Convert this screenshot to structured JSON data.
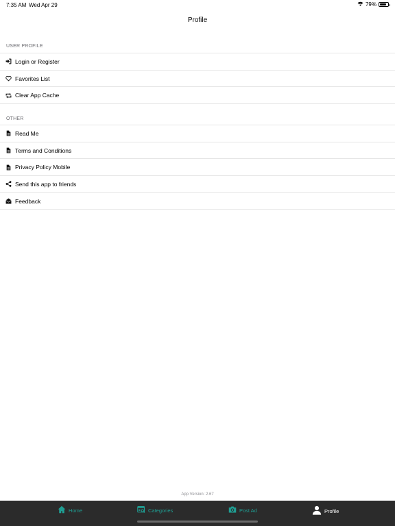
{
  "status_bar": {
    "time": "7:35 AM",
    "date": "Wed Apr 29",
    "battery": "79%",
    "battery_level": 0.79
  },
  "nav": {
    "title": "Profile"
  },
  "sections": [
    {
      "header": "USER PROFILE",
      "items": [
        {
          "label": "Login or Register",
          "icon": "sign-in-icon"
        },
        {
          "label": "Favorites List",
          "icon": "heart-icon"
        },
        {
          "label": "Clear App Cache",
          "icon": "retweet-icon"
        }
      ]
    },
    {
      "header": "OTHER",
      "items": [
        {
          "label": "Read Me",
          "icon": "document-icon"
        },
        {
          "label": "Terms and Conditions",
          "icon": "document-icon"
        },
        {
          "label": "Privacy Policy Mobile",
          "icon": "document-icon"
        },
        {
          "label": "Send this app to friends",
          "icon": "share-icon"
        },
        {
          "label": "Feedback",
          "icon": "envelope-open-icon"
        }
      ]
    }
  ],
  "footer": {
    "app_version": "App Version: 2.67"
  },
  "tab_bar": {
    "accent_color": "#1f9e93",
    "active_color": "#ffffff",
    "background": "#2b2b2b",
    "tabs": [
      {
        "label": "Home",
        "icon": "home-icon"
      },
      {
        "label": "Categories",
        "icon": "categories-icon"
      },
      {
        "label": "Post Ad",
        "icon": "camera-icon"
      },
      {
        "label": "Profile",
        "icon": "user-icon",
        "active": true
      }
    ]
  }
}
